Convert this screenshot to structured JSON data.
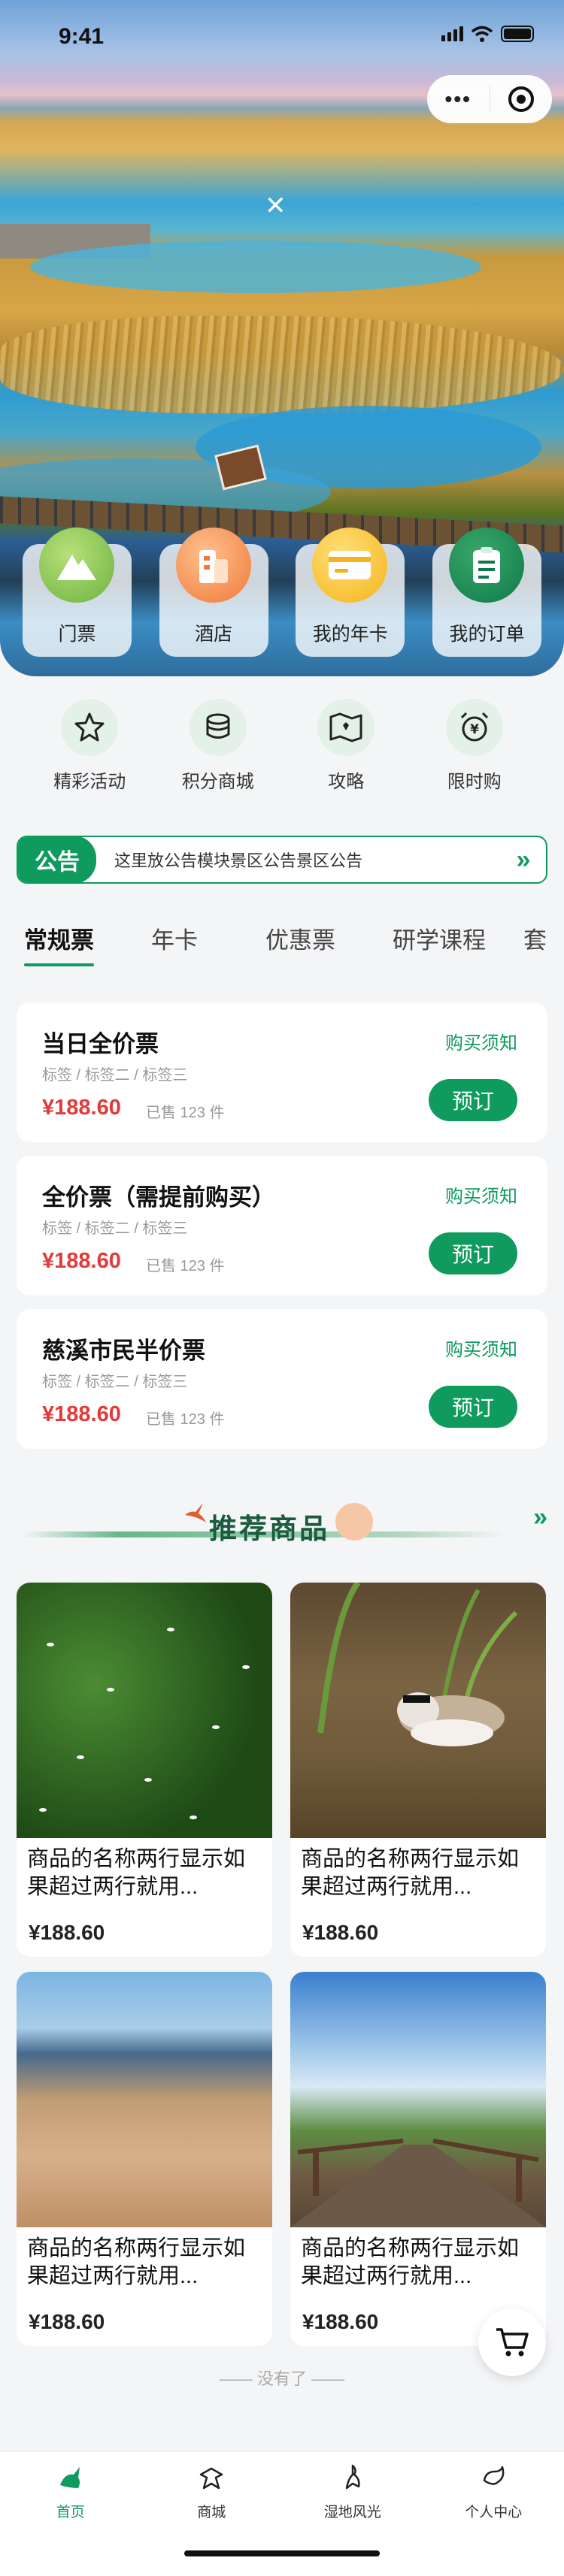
{
  "status": {
    "time": "9:41"
  },
  "capsule": {
    "more": "•••"
  },
  "hero": {
    "close_glyph": "✕"
  },
  "quick": [
    {
      "label": "门票",
      "icon": "mountain-icon"
    },
    {
      "label": "酒店",
      "icon": "hotel-icon"
    },
    {
      "label": "我的年卡",
      "icon": "card-icon"
    },
    {
      "label": "我的订单",
      "icon": "order-icon"
    }
  ],
  "subnav": [
    {
      "label": "精彩活动",
      "icon": "star-icon"
    },
    {
      "label": "积分商城",
      "icon": "coins-icon"
    },
    {
      "label": "攻略",
      "icon": "map-icon"
    },
    {
      "label": "限时购",
      "icon": "alarm-yen-icon"
    }
  ],
  "notice": {
    "tag": "公告",
    "text": "这里放公告模块景区公告景区公告",
    "arrow": "»"
  },
  "tabs": [
    "常规票",
    "年卡",
    "优惠票",
    "研学课程",
    "套"
  ],
  "tickets": [
    {
      "name": "当日全价票",
      "tags": "标签 / 标签二 / 标签三",
      "price": "¥188.60",
      "sold": "已售 123 件",
      "note": "购买须知",
      "button": "预订"
    },
    {
      "name": "全价票（需提前购买）",
      "tags": "标签 / 标签二 / 标签三",
      "price": "¥188.60",
      "sold": "已售 123 件",
      "note": "购买须知",
      "button": "预订"
    },
    {
      "name": "慈溪市民半价票",
      "tags": "标签 / 标签二 / 标签三",
      "price": "¥188.60",
      "sold": "已售 123 件",
      "note": "购买须知",
      "button": "预订"
    }
  ],
  "recommend": {
    "title": "推荐商品",
    "arrow": "»"
  },
  "products": [
    {
      "name": "商品的名称两行显示如果超过两行就用...",
      "price": "¥188.60"
    },
    {
      "name": "商品的名称两行显示如果超过两行就用...",
      "price": "¥188.60"
    },
    {
      "name": "商品的名称两行显示如果超过两行就用...",
      "price": "¥188.60"
    },
    {
      "name": "商品的名称两行显示如果超过两行就用...",
      "price": "¥188.60"
    }
  ],
  "end_text": "—— 没有了 ——",
  "tabbar": [
    {
      "label": "首页",
      "active": true
    },
    {
      "label": "商城",
      "active": false
    },
    {
      "label": "湿地风光",
      "active": false
    },
    {
      "label": "个人中心",
      "active": false
    }
  ],
  "colors": {
    "primary": "#0f9a5e",
    "price": "#e23a3a"
  }
}
